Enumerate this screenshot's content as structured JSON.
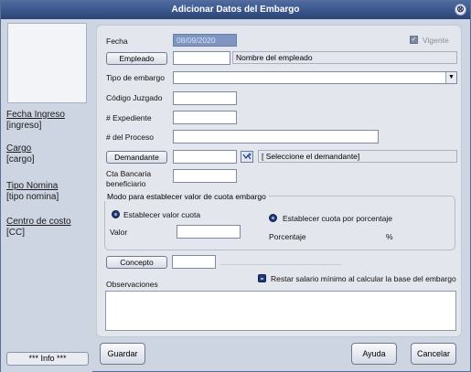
{
  "window": {
    "title": "Adicionar Datos del Embargo",
    "close_glyph": "⊗"
  },
  "left": {
    "fecha_ingreso_label": "Fecha Ingreso",
    "fecha_ingreso_value": "[ingreso]",
    "cargo_label": "Cargo",
    "cargo_value": "[cargo]",
    "tipo_nomina_label": "Tipo Nomina",
    "tipo_nomina_value": "[tipo nomina]",
    "centro_costo_label": "Centro de costo",
    "centro_costo_value": "[CC]",
    "info_button": "*** Info ***"
  },
  "form": {
    "fecha_label": "Fecha",
    "fecha_value": "08/09/2020",
    "vigente_label": "Vigente",
    "empleado_button": "Empleado",
    "empleado_code": "",
    "empleado_name": "Nombre del empleado",
    "tipo_embargo_label": "Tipo de embargo",
    "tipo_embargo_value": "",
    "codigo_juzgado_label": "Código Juzgado",
    "codigo_juzgado_value": "",
    "expediente_label": "# Expediente",
    "expediente_value": "",
    "proceso_label": "# del Proceso",
    "proceso_value": "",
    "demandante_button": "Demandante",
    "demandante_code": "",
    "demandante_name": "[ Seleccione el demandante]",
    "cta_label_1": "Cta Bancaria",
    "cta_label_2": "beneficiario",
    "cta_value": "",
    "group_title": "Modo para establecer valor de cuota embargo",
    "radio_valor_label": "Establecer valor cuota",
    "radio_porcentaje_label": "Establecer cuota por porcentaje",
    "valor_label": "Valor",
    "valor_value": "",
    "porcentaje_label": "Porcentaje",
    "porcentaje_symbol": "%",
    "concepto_button": "Concepto",
    "concepto_code": "",
    "restar_label": "Restar salario mínimo al calcular la base del embargo",
    "observaciones_label": "Observaciones",
    "observaciones_value": ""
  },
  "buttons": {
    "guardar": "Guardar",
    "ayuda": "Ayuda",
    "cancelar": "Cancelar"
  },
  "icons": {
    "close": "close-icon",
    "search": "search-person-icon",
    "dropdown": "chevron-down-icon"
  }
}
